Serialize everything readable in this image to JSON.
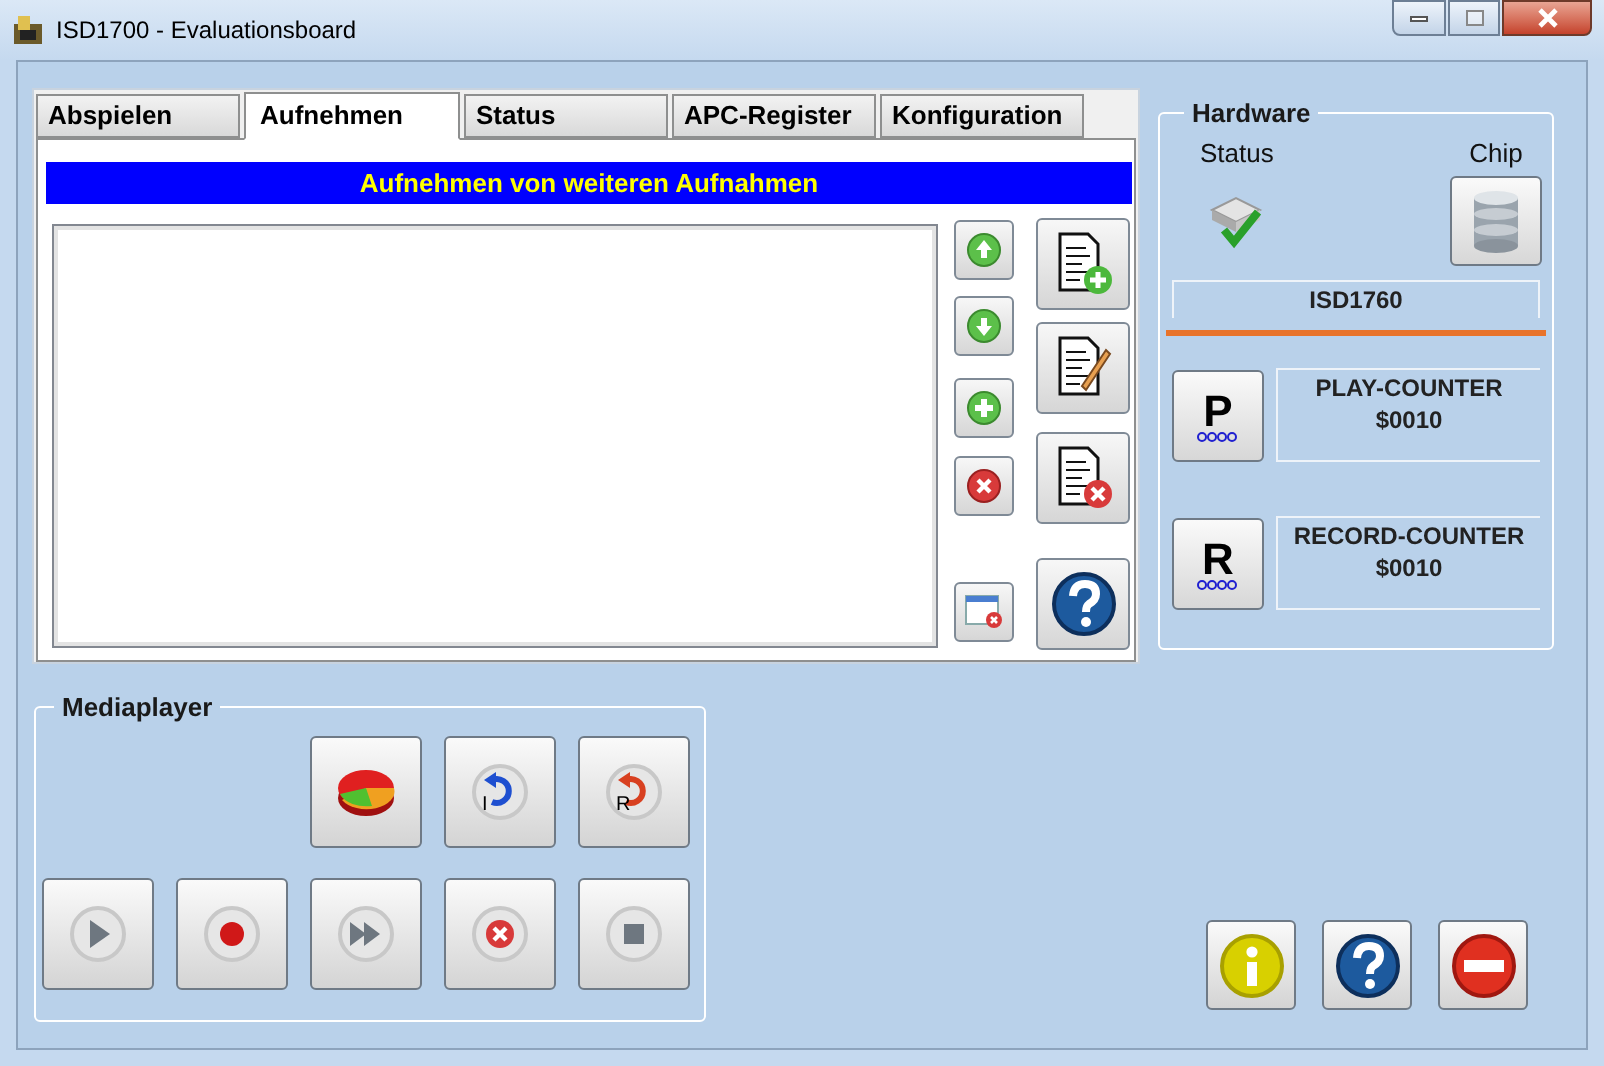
{
  "window": {
    "title": "ISD1700 - Evaluationsboard"
  },
  "tabs": [
    {
      "label": "Abspielen",
      "selected": false
    },
    {
      "label": "Aufnehmen",
      "selected": true
    },
    {
      "label": "Status",
      "selected": false
    },
    {
      "label": "APC-Register",
      "selected": false
    },
    {
      "label": "Konfiguration",
      "selected": false
    }
  ],
  "recording": {
    "banner": "Aufnehmen von weiteren Aufnahmen",
    "small_buttons": [
      {
        "kind": "up"
      },
      {
        "kind": "down"
      },
      {
        "kind": "add"
      },
      {
        "kind": "remove"
      },
      {
        "kind": "clear"
      }
    ],
    "big_buttons": [
      {
        "kind": "new"
      },
      {
        "kind": "edit"
      },
      {
        "kind": "delete"
      },
      {
        "kind": "help"
      }
    ]
  },
  "hardware": {
    "title": "Hardware",
    "status_label": "Status",
    "chip_label": "Chip",
    "chip": "ISD1760",
    "counters": [
      {
        "letter": "P",
        "label": "PLAY-COUNTER",
        "value": "$0010"
      },
      {
        "letter": "R",
        "label": "RECORD-COUNTER",
        "value": "$0010"
      }
    ]
  },
  "mediaplayer": {
    "title": "Mediaplayer",
    "rows": [
      [
        {
          "kind": "chart"
        },
        {
          "kind": "rewind",
          "letter": "I"
        },
        {
          "kind": "reset",
          "letter": "R"
        }
      ],
      [
        {
          "kind": "play"
        },
        {
          "kind": "record"
        },
        {
          "kind": "forward"
        },
        {
          "kind": "cancel"
        },
        {
          "kind": "stop"
        }
      ]
    ]
  },
  "footer_buttons": [
    {
      "kind": "info"
    },
    {
      "kind": "help"
    },
    {
      "kind": "exit"
    }
  ]
}
